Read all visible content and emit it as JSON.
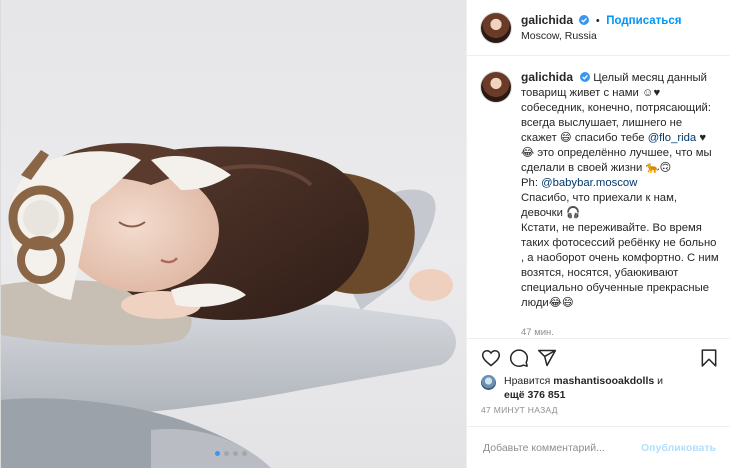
{
  "header": {
    "username": "galichida",
    "separator": "•",
    "follow_label": "Подписаться",
    "location": "Moscow, Russia"
  },
  "caption": {
    "username": "galichida",
    "lines": [
      "Целый месяц данный товарищ живет с нами ☺♥ собеседник, конечно, потрясающий: всегда выслушает, лишнего не скажет 😄 спасибо тебе",
      "@flo_rida",
      "♥ 😂 это определённо лучшее, что мы сделали в своей жизни 🐆🙃",
      "Ph: ",
      "@babybar.moscow",
      "Спасибо, что приехали к нам, девочки 🎧",
      "Кстати, не переживайте. Во время таких фотосессий ребёнку не больно , а наоборот очень комфортно. С ним возятся, носятся, убаюкивают специально обученные прекрасные люди😂😄"
    ],
    "time_ago": "47 мин."
  },
  "actions": {
    "like_icon": "heart-icon",
    "comment_icon": "comment-icon",
    "share_icon": "share-icon",
    "save_icon": "bookmark-icon"
  },
  "likes": {
    "prefix": "Нравится",
    "liker": "mashantisooakdolls",
    "conj": "и",
    "others": "ещё 376 851"
  },
  "timestamp": "47 МИНУТ НАЗАД",
  "comment": {
    "placeholder": "Добавьте комментарий...",
    "publish_label": "Опубликовать"
  },
  "carousel": {
    "count": 4,
    "active_index": 0
  },
  "colors": {
    "accent": "#0095f6",
    "publish_disabled": "#b2dffc",
    "muted": "#8e8e8e",
    "jacket": "#3f2a22",
    "pants": "#6b4a2c"
  }
}
